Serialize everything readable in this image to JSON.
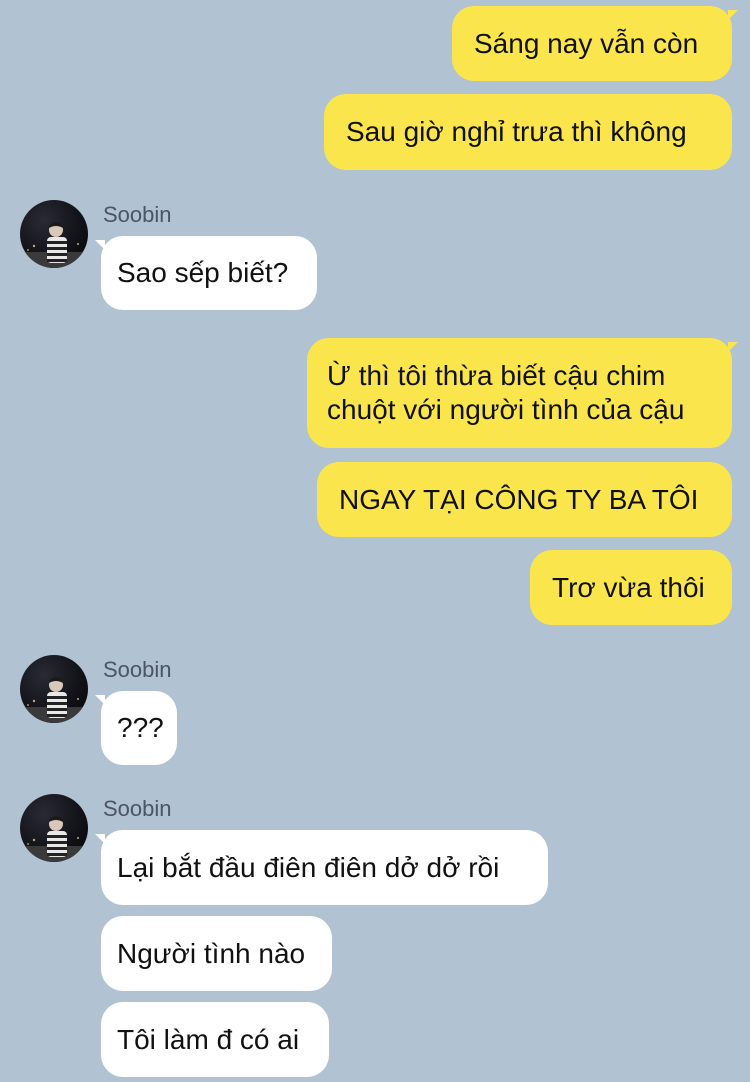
{
  "colors": {
    "background": "#b1c2d3",
    "outgoing_bubble": "#fae64c",
    "incoming_bubble": "#ffffff"
  },
  "messages": [
    {
      "direction": "out",
      "text": "Sáng nay vẫn còn"
    },
    {
      "direction": "out",
      "text": "Sau giờ nghỉ trưa thì không"
    },
    {
      "direction": "in",
      "sender": "Soobin",
      "avatar": "avatar-icon",
      "text": "Sao sếp biết?"
    },
    {
      "direction": "out",
      "text": "Ừ thì tôi thừa biết cậu chim chuột với người tình của cậu"
    },
    {
      "direction": "out",
      "text": "NGAY TẠI CÔNG TY BA TÔI"
    },
    {
      "direction": "out",
      "text": "Trơ vừa thôi"
    },
    {
      "direction": "in",
      "sender": "Soobin",
      "avatar": "avatar-icon",
      "text": "???"
    },
    {
      "direction": "in",
      "sender": "Soobin",
      "avatar": "avatar-icon",
      "text": "Lại bắt đầu điên điên dở dở rồi"
    },
    {
      "direction": "in",
      "text": "Người tình nào"
    },
    {
      "direction": "in",
      "text": "Tôi làm đ có ai"
    }
  ]
}
